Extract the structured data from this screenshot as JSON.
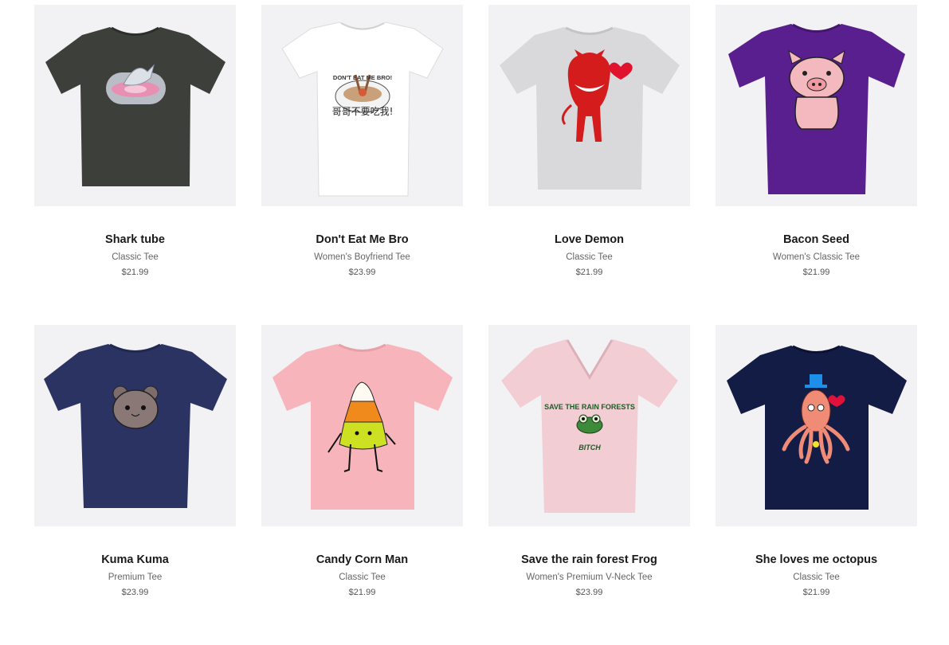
{
  "products": [
    {
      "title": "Shark tube",
      "type": "Classic Tee",
      "price": "$21.99",
      "shirt_color": "#3c3f3a",
      "icon": "shark-tube-icon"
    },
    {
      "title": "Don't Eat Me Bro",
      "type": "Women's Boyfriend Tee",
      "price": "$23.99",
      "shirt_color": "#ffffff",
      "icon": "rabbit-bowl-icon",
      "art_text_top": "DON'T EAT ME BRO!",
      "art_text_bottom": "哥哥不要吃我!"
    },
    {
      "title": "Love Demon",
      "type": "Classic Tee",
      "price": "$21.99",
      "shirt_color": "#d9d9db",
      "icon": "red-demon-icon"
    },
    {
      "title": "Bacon Seed",
      "type": "Women's Classic Tee",
      "price": "$21.99",
      "shirt_color": "#5a1f8f",
      "icon": "pig-icon"
    },
    {
      "title": "Kuma Kuma",
      "type": "Premium Tee",
      "price": "$23.99",
      "shirt_color": "#2b3363",
      "icon": "bear-face-icon"
    },
    {
      "title": "Candy Corn Man",
      "type": "Classic Tee",
      "price": "$21.99",
      "shirt_color": "#f7b5bb",
      "icon": "candy-corn-icon"
    },
    {
      "title": "Save the rain forest Frog",
      "type": "Women's Premium V-Neck Tee",
      "price": "$23.99",
      "shirt_color": "#f2cdd3",
      "icon": "frog-icon",
      "art_text_top": "SAVE THE RAIN FORESTS",
      "art_text_bottom": "BITCH"
    },
    {
      "title": "She loves me octopus",
      "type": "Classic Tee",
      "price": "$21.99",
      "shirt_color": "#131c45",
      "icon": "octopus-icon"
    }
  ]
}
